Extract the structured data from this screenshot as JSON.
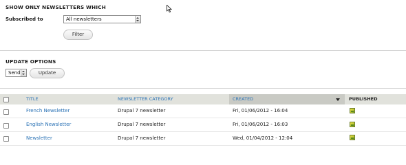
{
  "filter_section": {
    "title": "SHOW ONLY NEWSLETTERS WHICH",
    "subscribed_label": "Subscribed to",
    "subscribed_value": "All newsletters",
    "filter_button": "Filter"
  },
  "update_section": {
    "title": "UPDATE OPTIONS",
    "action_value": "Send",
    "update_button": "Update"
  },
  "table": {
    "columns": {
      "title": "TITLE",
      "category": "NEWSLETTER CATEGORY",
      "created": "CREATED",
      "published": "PUBLISHED"
    },
    "sorted_column": "created",
    "sort_direction": "descending",
    "rows": [
      {
        "title": "French Newsletter",
        "category": "Drupal 7 newsletter",
        "created": "Fri, 01/06/2012 - 16:04",
        "published": true
      },
      {
        "title": "English Newsletter",
        "category": "Drupal 7 newsletter",
        "created": "Fri, 01/06/2012 - 16:03",
        "published": true
      },
      {
        "title": "Newsletter",
        "category": "Drupal 7 newsletter",
        "created": "Wed, 01/04/2012 - 12:04",
        "published": true
      }
    ]
  },
  "colors": {
    "link": "#2a72b5",
    "header_bg": "#e1e2dc",
    "sorted_header_bg": "#c9cac4"
  },
  "icons": {
    "published": "published-check-icon",
    "sort": "sort-desc-icon",
    "select_arrow": "select-arrows-icon"
  }
}
